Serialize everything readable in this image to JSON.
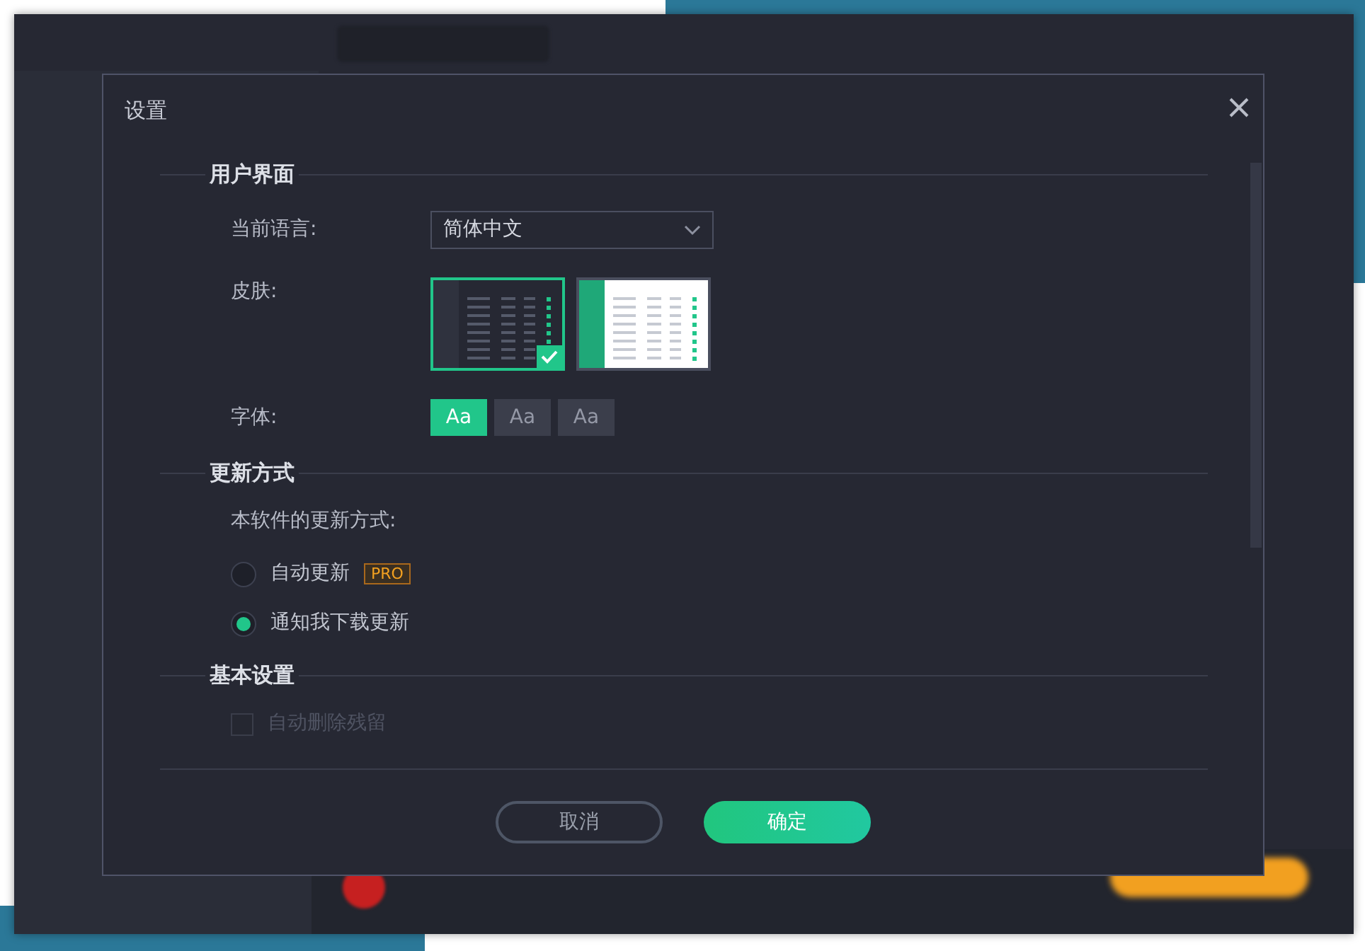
{
  "dialog": {
    "title": "设置",
    "sections": [
      {
        "title": "用户界面",
        "rows": [
          {
            "kind": "select",
            "label": "当前语言:",
            "value": "简体中文"
          },
          {
            "kind": "skins",
            "label": "皮肤:",
            "options": [
              {
                "kind": "dark",
                "selected": true
              },
              {
                "kind": "light",
                "selected": false
              }
            ]
          },
          {
            "kind": "fonts",
            "label": "字体:",
            "options": [
              {
                "label": "Aa",
                "selected": true
              },
              {
                "label": "Aa",
                "selected": false
              },
              {
                "label": "Aa",
                "selected": false
              }
            ]
          }
        ]
      },
      {
        "title": "更新方式",
        "rows": [
          {
            "kind": "text",
            "label": "本软件的更新方式:"
          },
          {
            "kind": "radio",
            "label": "自动更新",
            "badge": "PRO",
            "selected": false
          },
          {
            "kind": "radio",
            "label": "通知我下载更新",
            "selected": true
          }
        ]
      },
      {
        "title": "基本设置",
        "rows": [
          {
            "kind": "checkbox",
            "label": "自动删除残留",
            "checked": false,
            "disabled": true
          }
        ]
      }
    ],
    "buttons": [
      {
        "label": "取消",
        "kind": "secondary"
      },
      {
        "label": "确定",
        "kind": "primary"
      }
    ]
  }
}
